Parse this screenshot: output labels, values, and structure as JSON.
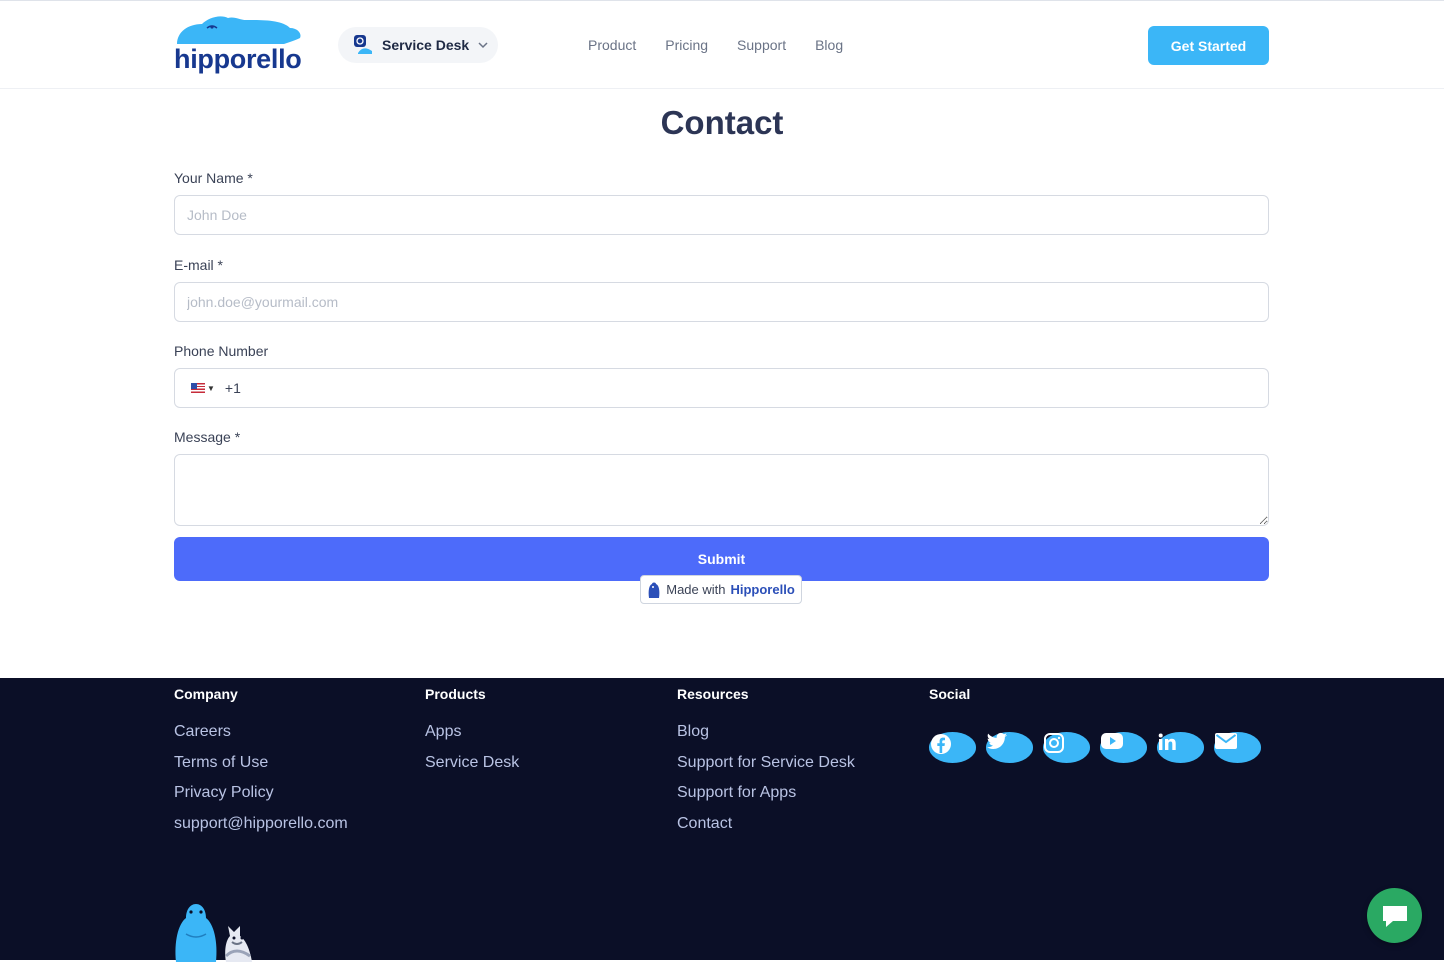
{
  "header": {
    "logo_text": "hipporello",
    "product_switch": {
      "label": "Service Desk",
      "icon": "service-desk-icon"
    },
    "nav": [
      "Product",
      "Pricing",
      "Support",
      "Blog"
    ],
    "cta_label": "Get Started"
  },
  "page": {
    "title": "Contact"
  },
  "form": {
    "name": {
      "label": "Your Name *",
      "placeholder": "John Doe",
      "value": ""
    },
    "email": {
      "label": "E-mail *",
      "placeholder": "john.doe@yourmail.com",
      "value": ""
    },
    "phone": {
      "label": "Phone Number",
      "country": "US",
      "dial_code": "+1",
      "value": ""
    },
    "message": {
      "label": "Message *",
      "value": ""
    },
    "submit_label": "Submit"
  },
  "badge": {
    "prefix": "Made with",
    "brand": "Hipporello"
  },
  "footer": {
    "columns": [
      {
        "title": "Company",
        "links": [
          "Careers",
          "Terms of Use",
          "Privacy Policy",
          "support@hipporello.com"
        ]
      },
      {
        "title": "Products",
        "links": [
          "Apps",
          "Service Desk"
        ]
      },
      {
        "title": "Resources",
        "links": [
          "Blog",
          "Support for Service Desk",
          "Support for Apps",
          "Contact"
        ]
      },
      {
        "title": "Social",
        "icons": [
          "facebook-icon",
          "twitter-icon",
          "instagram-icon",
          "youtube-icon",
          "linkedin-icon",
          "mail-icon"
        ]
      }
    ]
  },
  "chat": {
    "icon": "chat-bubble-icon"
  },
  "colors": {
    "accent": "#3bb6f7",
    "submit": "#4d6bfa",
    "footer_bg": "#0b0f27",
    "chat": "#2aa963"
  }
}
